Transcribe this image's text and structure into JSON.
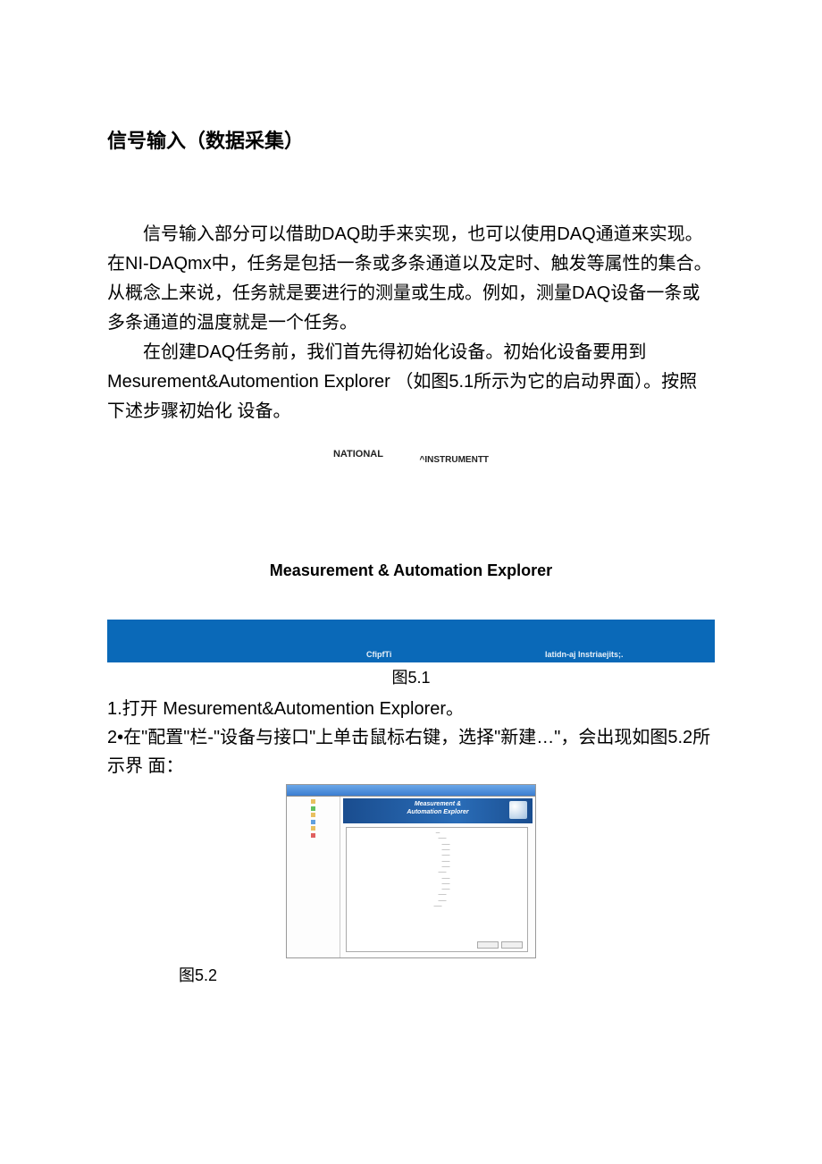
{
  "title": "信号输入（数据采集）",
  "paragraphs": {
    "p1": "信号输入部分可以借助DAQ助手来实现，也可以使用DAQ通道来实现。在NI-DAQmx中，任务是包括一条或多条通道以及定时、触发等属性的集合。从概念上来说，任务就是要进行的测量或生成。例如，测量DAQ设备一条或多条通道的温度就是一个任务。",
    "p2": "在创建DAQ任务前，我们首先得初始化设备。初始化设备要用到Mesurement&Automention Explorer （如图5.1所示为它的启动界面）。按照下述步骤初始化 设备。"
  },
  "splash": {
    "national": "NATIONAL",
    "instruments": "^INSTRUMENTT",
    "mae_title": "Measurement & Automation Explorer",
    "bar_left": "CfipfTi",
    "bar_right": "Iatidn-aj Instriaejits;."
  },
  "fig_caption_51": "图5.1",
  "steps": {
    "s1": "1.打开 Mesurement&Automention Explorer。",
    "s2": "2•在\"配置\"栏-\"设备与接口\"上单击鼠标右键，选择\"新建…\"，会出现如图5.2所示界 面："
  },
  "fig52": {
    "banner_line1": "Measurement &",
    "banner_line2": "Automation Explorer"
  },
  "fig_caption_52": "图5.2"
}
